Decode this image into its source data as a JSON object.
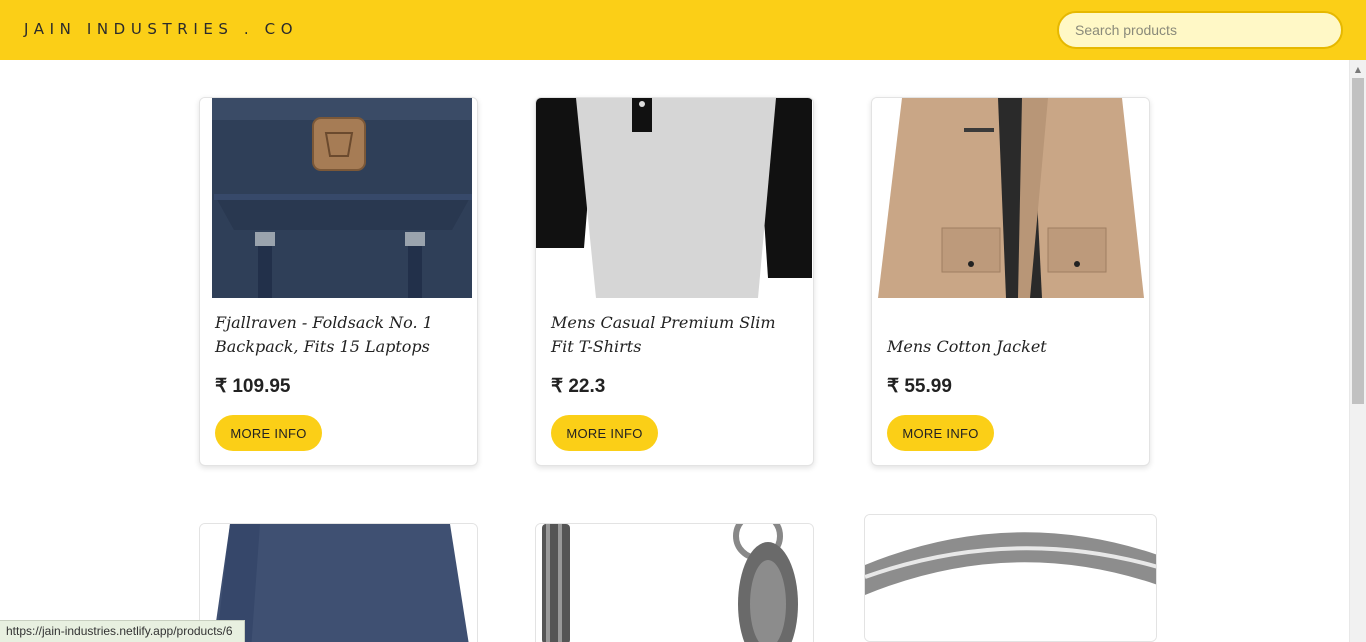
{
  "header": {
    "brand": "JAIN INDUSTRIES . CO",
    "search_placeholder": "Search products"
  },
  "products": [
    {
      "title": "Fjallraven - Foldsack No. 1 Backpack, Fits 15 Laptops",
      "price": "₹ 109.95",
      "button": "MORE INFO",
      "icon": "backpack-image"
    },
    {
      "title": "Mens Casual Premium Slim Fit T-Shirts",
      "price": "₹ 22.3",
      "button": "MORE INFO",
      "icon": "tshirt-image"
    },
    {
      "title": "Mens Cotton Jacket",
      "price": "₹ 55.99",
      "button": "MORE INFO",
      "icon": "jacket-image"
    }
  ],
  "more_products": [
    {
      "icon": "long-sleeve-shirt-image"
    },
    {
      "icon": "bracelet-image"
    },
    {
      "icon": "ring-image"
    }
  ],
  "status": {
    "url": "https://jain-industries.netlify.app/products/6"
  },
  "colors": {
    "accent": "#fbcf17",
    "search_bg": "#fff8c6"
  }
}
